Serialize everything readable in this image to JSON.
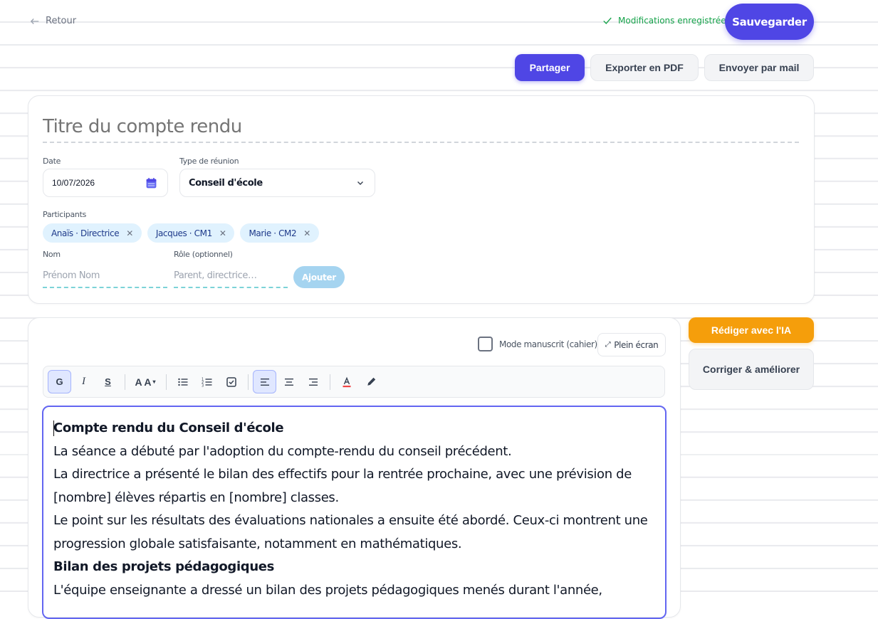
{
  "header": {
    "back_label": "Retour",
    "saved_status": "Modifications enregistrées",
    "save_button": "Sauvegarder"
  },
  "actions": {
    "share": "Partager",
    "export_pdf": "Exporter en PDF",
    "send_mail": "Envoyer par mail"
  },
  "form": {
    "title_placeholder": "Titre du compte rendu",
    "date_label": "Date",
    "date_value": "10/07/2026",
    "meeting_type_label": "Type de réunion",
    "meeting_type_value": "Conseil d'école",
    "participants_label": "Participants",
    "participants": [
      {
        "label": "Anaïs · Directrice"
      },
      {
        "label": "Jacques · CM1"
      },
      {
        "label": "Marie · CM2"
      }
    ],
    "name_label": "Nom",
    "name_placeholder": "Prénom Nom",
    "role_label": "Rôle (optionnel)",
    "role_placeholder": "Parent, directrice…",
    "add_button": "Ajouter"
  },
  "editor_panel": {
    "handwriting_mode": "Mode manuscrit (cahier)",
    "fullscreen": "Plein écran",
    "toolbar": {
      "bold": "G",
      "italic": "I",
      "strike": "S",
      "font_size": "A A"
    },
    "content": [
      {
        "text": "Compte rendu du Conseil d'école",
        "heading": true
      },
      {
        "text": "La séance a débuté par l'adoption du compte-rendu du conseil précédent."
      },
      {
        "text": "La directrice a présenté le bilan des effectifs pour la rentrée prochaine, avec une prévision de [nombre] élèves répartis en [nombre] classes."
      },
      {
        "text": "Le point sur les résultats des évaluations nationales a ensuite été abordé. Ceux-ci montrent une progression globale satisfaisante, notamment en mathématiques."
      },
      {
        "text": "Bilan des projets pédagogiques",
        "heading": true
      },
      {
        "text": "L'équipe enseignante a dressé un bilan des projets pédagogiques menés durant l'année,"
      }
    ]
  },
  "side": {
    "ai_button": "Rédiger avec l'IA",
    "correct_button": "Corriger & améliorer"
  },
  "colors": {
    "primary": "#4f46e5",
    "accent": "#f59e0b",
    "success": "#16a34a"
  }
}
